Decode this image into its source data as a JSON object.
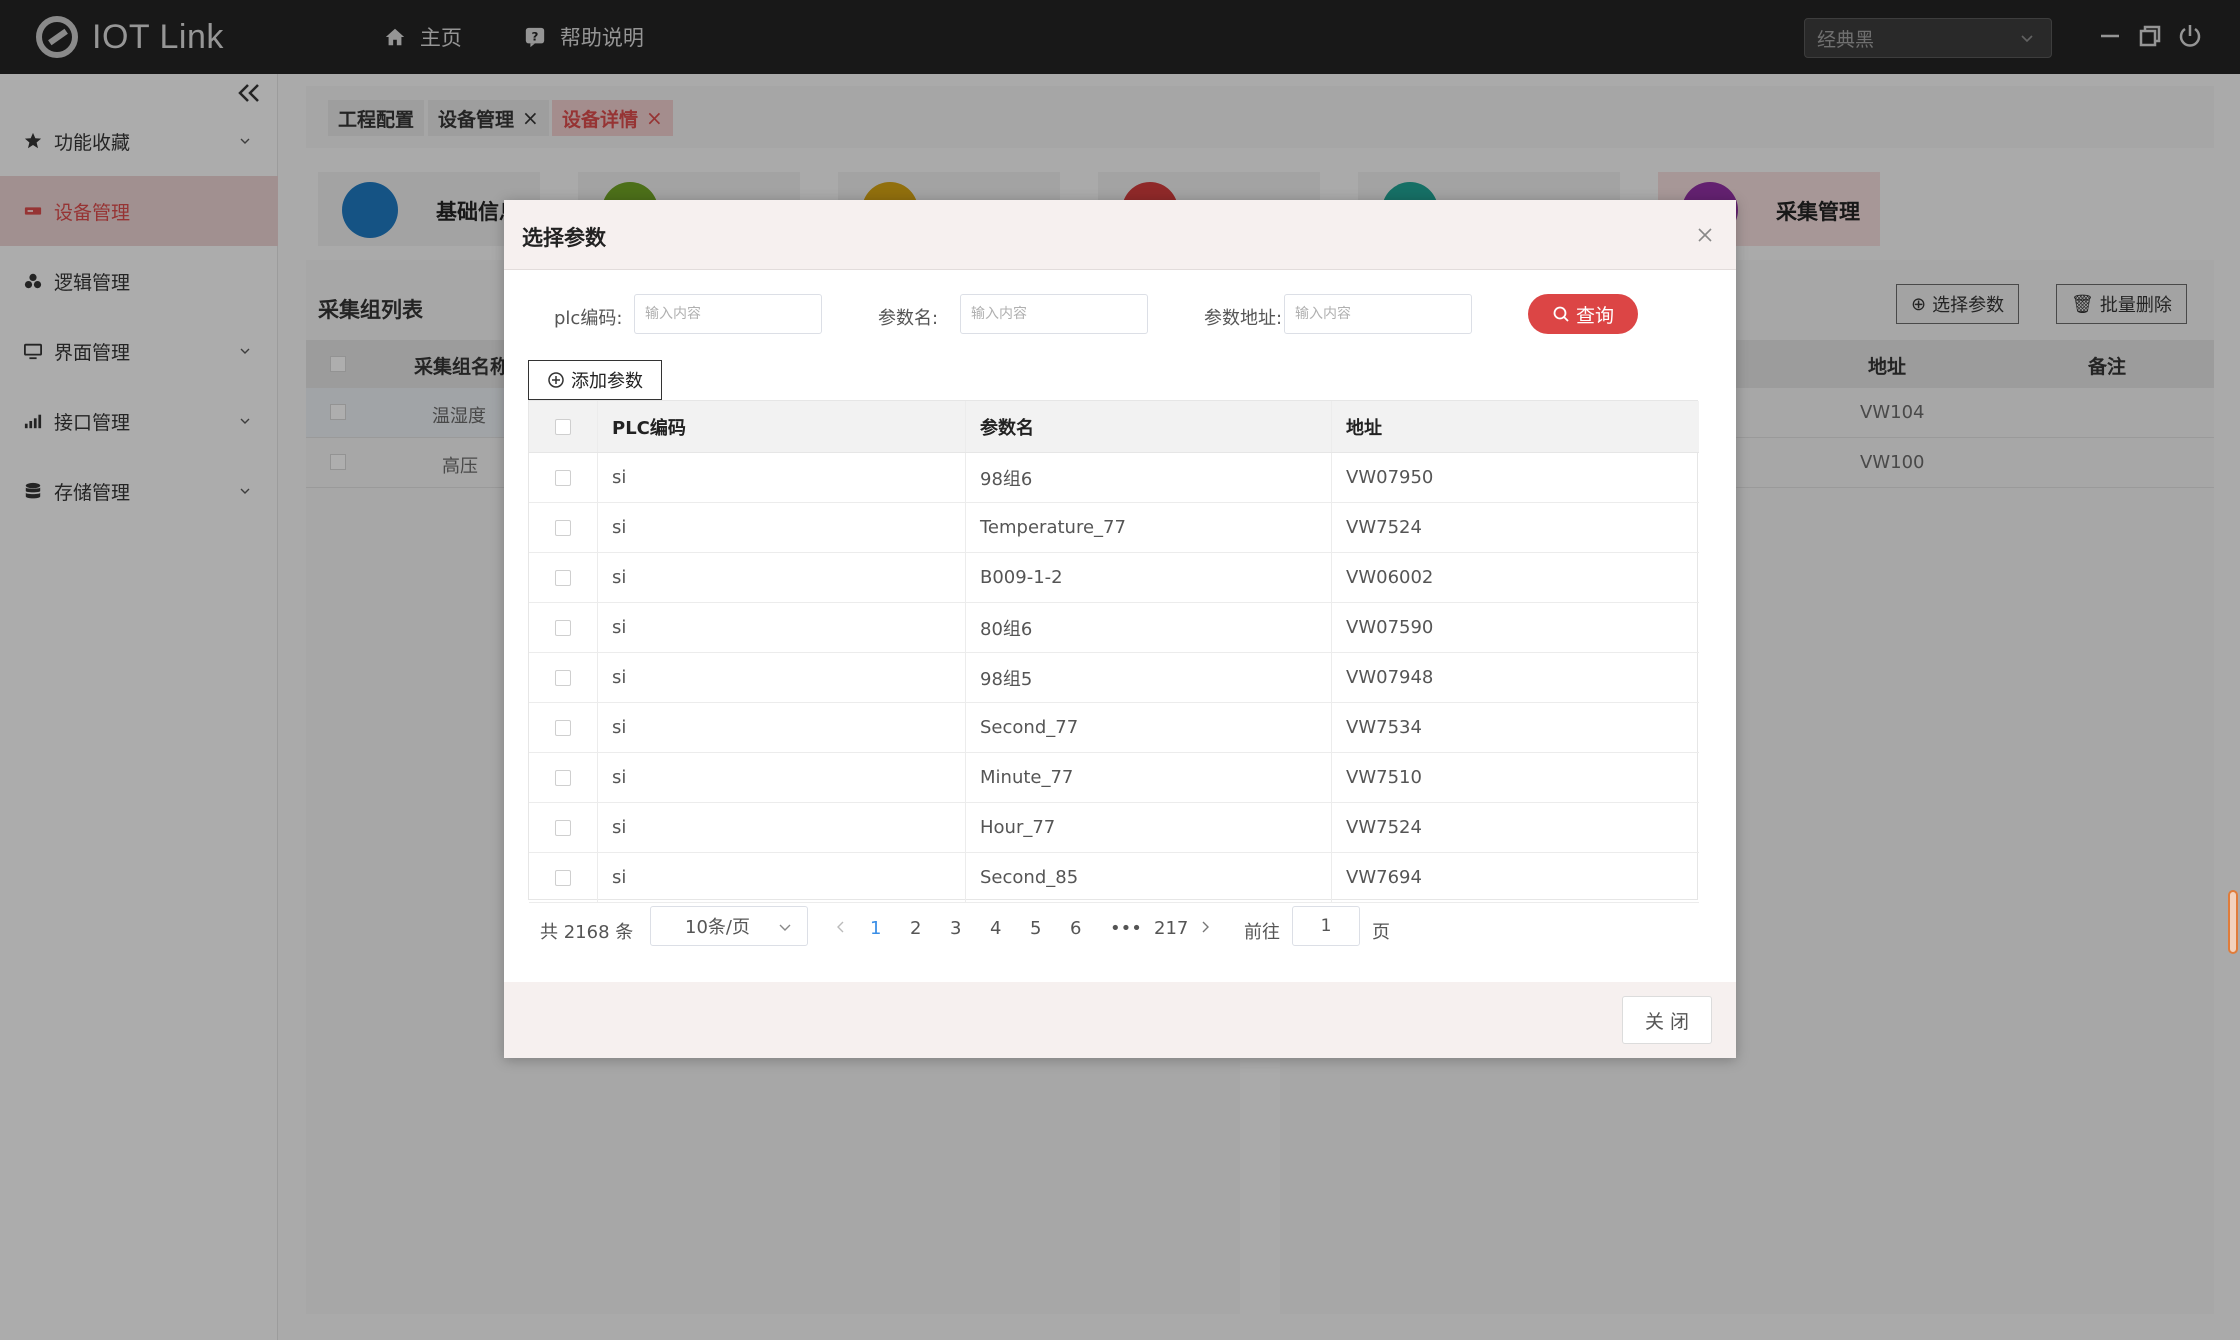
{
  "app": {
    "title": "IOT Link"
  },
  "topnav": [
    {
      "label": "主页",
      "icon": "home-icon"
    },
    {
      "label": "帮助说明",
      "icon": "help-icon"
    }
  ],
  "theme": {
    "selected": "经典黑"
  },
  "sidebar": {
    "items": [
      {
        "label": "功能收藏",
        "icon": "star-icon",
        "expandable": true
      },
      {
        "label": "设备管理",
        "icon": "device-icon",
        "active": true
      },
      {
        "label": "逻辑管理",
        "icon": "logic-icon"
      },
      {
        "label": "界面管理",
        "icon": "monitor-icon",
        "expandable": true
      },
      {
        "label": "接口管理",
        "icon": "signal-icon",
        "expandable": true
      },
      {
        "label": "存储管理",
        "icon": "database-icon",
        "expandable": true
      }
    ]
  },
  "tabs": [
    {
      "label": "工程配置"
    },
    {
      "label": "设备管理",
      "closable": true
    },
    {
      "label": "设备详情",
      "closable": true,
      "active": true
    }
  ],
  "modules": [
    {
      "label": "基础信息",
      "color": "#1e73b8"
    },
    {
      "label": "",
      "color": "#6a9a23"
    },
    {
      "label": "",
      "color": "#c99a12"
    },
    {
      "label": "",
      "color": "#c63a3a"
    },
    {
      "label": "",
      "color": "#1f9a8c"
    },
    {
      "label": "采集管理",
      "color": "#8a2f9b"
    }
  ],
  "left_panel": {
    "title": "采集组列表",
    "column": "采集组名称",
    "rows": [
      "温湿度",
      "高压"
    ]
  },
  "right_panel": {
    "buttons": {
      "select": "选择参数",
      "batch_delete": "批量删除"
    },
    "columns": {
      "addr": "地址",
      "note": "备注"
    },
    "rows": [
      "VW104",
      "VW100"
    ]
  },
  "dialog": {
    "title": "选择参数",
    "filters": {
      "plc_label": "plc编码:",
      "name_label": "参数名:",
      "addr_label": "参数地址:",
      "placeholder": "输入内容"
    },
    "query_label": "查询",
    "add_label": "添加参数",
    "columns": {
      "plc": "PLC编码",
      "name": "参数名",
      "addr": "地址"
    },
    "rows": [
      {
        "plc": "si",
        "name": "98组6",
        "addr": "VW07950"
      },
      {
        "plc": "si",
        "name": "Temperature_77",
        "addr": "VW7524"
      },
      {
        "plc": "si",
        "name": "B009-1-2",
        "addr": "VW06002"
      },
      {
        "plc": "si",
        "name": "80组6",
        "addr": "VW07590"
      },
      {
        "plc": "si",
        "name": "98组5",
        "addr": "VW07948"
      },
      {
        "plc": "si",
        "name": "Second_77",
        "addr": "VW7534"
      },
      {
        "plc": "si",
        "name": "Minute_77",
        "addr": "VW7510"
      },
      {
        "plc": "si",
        "name": "Hour_77",
        "addr": "VW7524"
      },
      {
        "plc": "si",
        "name": "Second_85",
        "addr": "VW7694"
      }
    ],
    "pagination": {
      "total_text": "共 2168 条",
      "page_size": "10条/页",
      "pages": [
        "1",
        "2",
        "3",
        "4",
        "5",
        "6",
        "•••",
        "217"
      ],
      "current": "1",
      "goto_label": "前往",
      "goto_value": "1",
      "page_suffix": "页"
    },
    "close_label": "关 闭"
  }
}
